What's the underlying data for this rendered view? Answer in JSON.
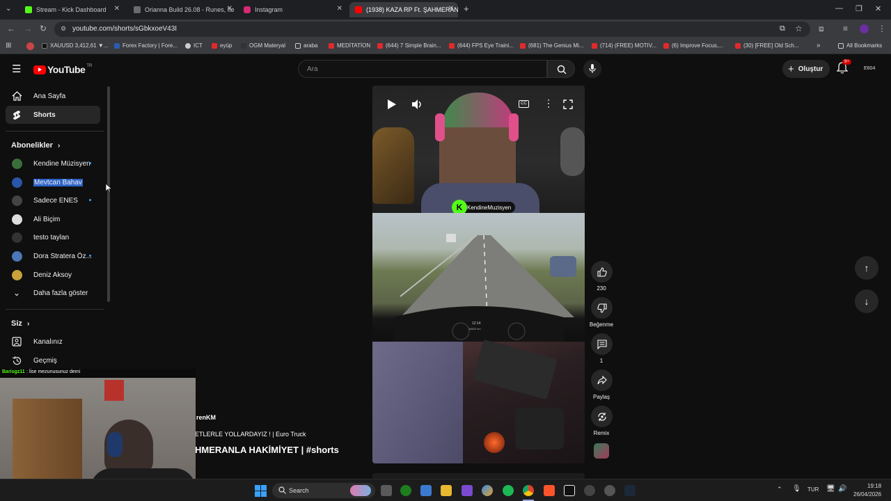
{
  "browser": {
    "tabs": [
      {
        "title": "Stream - Kick Dashboard",
        "color": "#53fc18"
      },
      {
        "title": "Orianna Build 26.08 - Runes, Ite",
        "color": "#6b6b6b"
      },
      {
        "title": "Instagram",
        "color": "#d62976"
      },
      {
        "title": "(1938) KAZA RP Ft. ŞAHMERAN",
        "color": "#ff0000"
      }
    ],
    "url": "youtube.com/shorts/sGbkxoeV43I",
    "bookmarks": [
      "XAUUSD 3,412,61 ▼...",
      "Forex Factory | Fore...",
      "ICT",
      "eyüp",
      "OGM Materyal",
      "araba",
      "MEDİTATİON",
      "(644) 7 Simple Brain...",
      "(644) FPS Eye Traini...",
      "(681) The Genius Mi...",
      "(714) (FREE) MOTIV...",
      "(6) Improve Focus,...",
      "(30) [FREE] Old Sch..."
    ],
    "all_bookmarks": "All Bookmarks"
  },
  "header": {
    "logo_text": "YouTube",
    "logo_region": "TR",
    "search_placeholder": "Ara",
    "create_label": "Oluştur",
    "notif_badge": "9+",
    "account": "E604"
  },
  "sidebar": {
    "top": [
      {
        "label": "Ana Sayfa"
      },
      {
        "label": "Shorts"
      }
    ],
    "subs_heading": "Abonelikler",
    "subs": [
      {
        "label": "Kendine Müzisyen",
        "color": "#3b6e3b"
      },
      {
        "label": "Mevtcan Bahav",
        "color": "#2956a8"
      },
      {
        "label": "Sadece ENES",
        "color": "#444444"
      },
      {
        "label": "Ali Biçim",
        "color": "#dddddd"
      },
      {
        "label": "testo taylan",
        "color": "#333333"
      },
      {
        "label": "Dora Stratera Öz...",
        "color": "#4a78b8"
      },
      {
        "label": "Deniz Aksoy",
        "color": "#c9a23a"
      }
    ],
    "more_label": "Daha fazla göster",
    "you_heading": "Siz",
    "you": [
      {
        "label": "Kanalınız"
      },
      {
        "label": "Geçmiş"
      }
    ]
  },
  "short": {
    "channel_tag": "KendineMuzisyen",
    "hud_speed": "12:14",
    "hud_line": "18820 km",
    "overlay_channel": "renKM",
    "overlay_title_line": "ETLERLE YOLLARDAYIZ ! | Euro Truck",
    "overlay_title_big": "HMERANLA HAKİMİYET | #shorts"
  },
  "actions": {
    "like_count": "230",
    "dislike_label": "Beğenme",
    "comment_count": "1",
    "share_label": "Paylaş",
    "remix_label": "Remix"
  },
  "chat": {
    "user": "Barisgz11",
    "message": "lise mezunusunuz demi"
  },
  "taskbar": {
    "search_label": "Search",
    "lang": "TUR",
    "time": "19:18",
    "date": "26/04/2026"
  }
}
